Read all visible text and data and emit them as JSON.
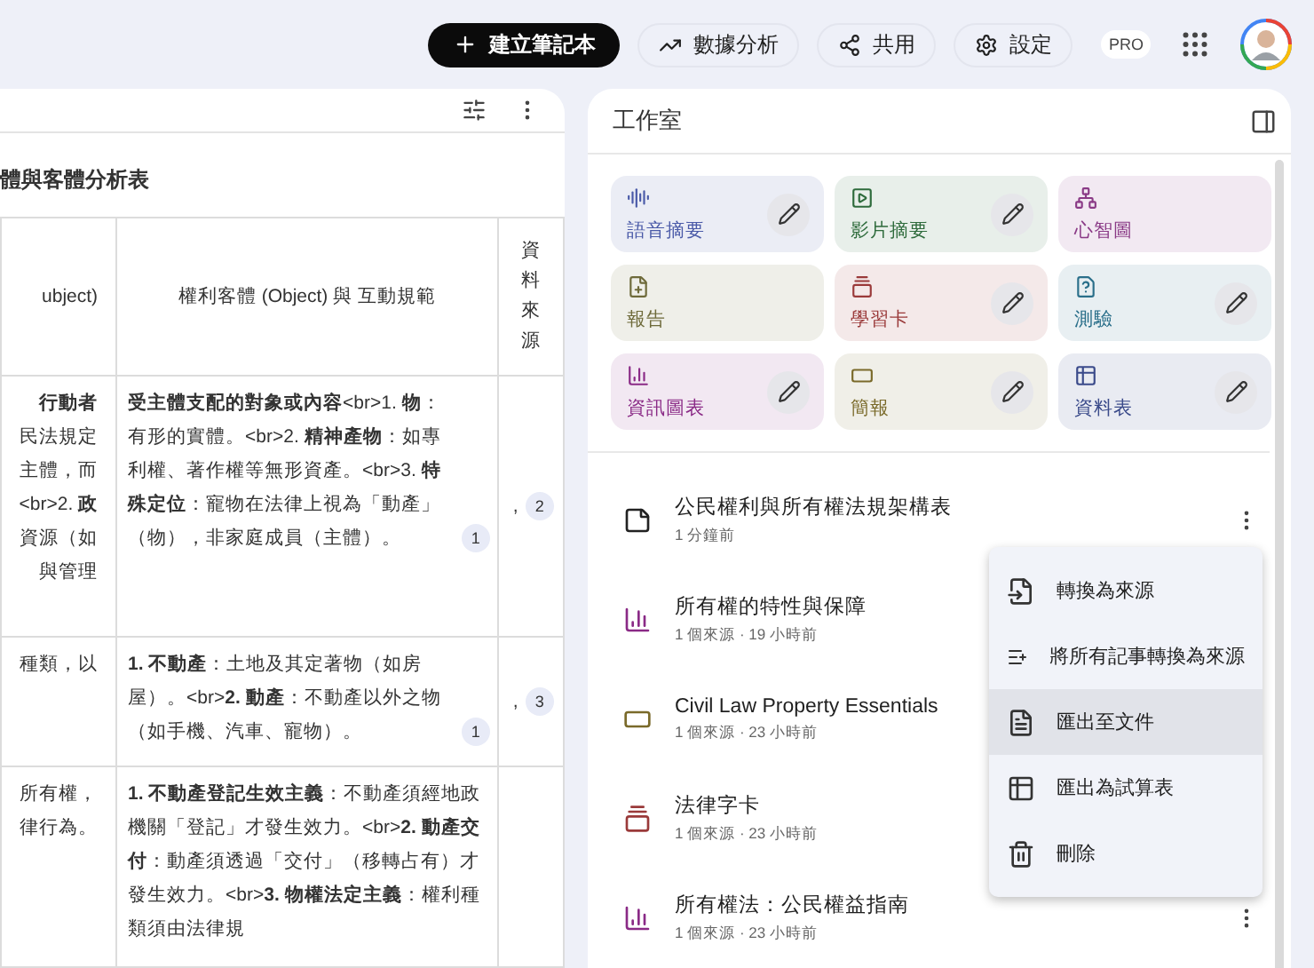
{
  "topbar": {
    "create_button": "建立筆記本",
    "buttons": [
      {
        "kind": "analytics",
        "label": "數據分析"
      },
      {
        "kind": "share",
        "label": "共用"
      },
      {
        "kind": "settings",
        "label": "設定"
      }
    ],
    "badge": "PRO"
  },
  "document": {
    "title": "體與客體分析表",
    "header": [
      "ubject)",
      "權利客體 (Object) 與 互動規範",
      "資料來源"
    ],
    "rows": [
      {
        "col1": [
          {
            "text": "**行動者**"
          },
          {
            "text": "民法規定"
          },
          {
            "text": "主體，而"
          },
          {
            "text": "<br>2. **政**"
          },
          {
            "text": "資源（如"
          },
          {
            "text": "與管理"
          }
        ],
        "col2": "**受主體支配的對象或內容**<br>1. **物**：有形的實體。<br>2. **精神產物**：如專利權、著作權等無形資產。<br>3. **特殊定位**：寵物在法律上視為「動產」（物），非家庭成員（主體）。",
        "col2_citation": "1",
        "col3_prefix": ",",
        "col3_citation": "2"
      },
      {
        "col1": [
          {
            "text": "種類，以"
          }
        ],
        "col2": "**1. 不動產**：土地及其定著物（如房屋）。<br>**2. 動產**：不動產以外之物（如手機、汽車、寵物）。",
        "col2_citation": "1",
        "col3_prefix": ",",
        "col3_citation": "3"
      },
      {
        "col1": [
          {
            "text": "所有權，"
          },
          {
            "text": "律行為。"
          }
        ],
        "col2": "**1. 不動產登記生效主義**：不動產須經地政機關「登記」才發生效力。<br>**2. 動產交付**：動產須透過「交付」（移轉占有）才發生效力。<br>**3. 物權法定主義**：權利種類須由法律規"
      }
    ]
  },
  "studio": {
    "title": "工作室",
    "tiles": [
      {
        "kind": "audio",
        "label": "語音摘要",
        "color": "#4a5aa8",
        "editable": true
      },
      {
        "kind": "video",
        "label": "影片摘要",
        "color": "#2e6b3c",
        "editable": true
      },
      {
        "kind": "mindmap",
        "label": "心智圖",
        "color": "#8a3a86",
        "editable": false
      },
      {
        "kind": "report",
        "label": "報告",
        "color": "#6e6a3a",
        "editable": false
      },
      {
        "kind": "flashcards",
        "label": "學習卡",
        "color": "#9a3a3a",
        "editable": true
      },
      {
        "kind": "quiz",
        "label": "測驗",
        "color": "#2a6f8a",
        "editable": true
      },
      {
        "kind": "infographic",
        "label": "資訊圖表",
        "color": "#8a2a86",
        "editable": true
      },
      {
        "kind": "slides",
        "label": "簡報",
        "color": "#7a6a2a",
        "editable": true
      },
      {
        "kind": "table",
        "label": "資料表",
        "color": "#3a4a8a",
        "editable": true
      }
    ],
    "notes": [
      {
        "kind": "note",
        "title": "公民權利與所有權法規架構表",
        "meta": "1 分鐘前",
        "more": true
      },
      {
        "kind": "infographic",
        "title": "所有權的特性與保障",
        "meta": "1 個來源 · 19 小時前"
      },
      {
        "kind": "slides",
        "title": "Civil Law Property Essentials",
        "meta": "1 個來源 · 23 小時前"
      },
      {
        "kind": "flashcards",
        "title": "法律字卡",
        "meta": "1 個來源 · 23 小時前"
      },
      {
        "kind": "infographic",
        "title": "所有權法：公民權益指南",
        "meta": "1 個來源 · 23 小時前",
        "more": true
      }
    ],
    "menu": [
      {
        "kind": "convert",
        "label": "轉換為來源",
        "selected": false
      },
      {
        "kind": "convert_all",
        "label": "將所有記事轉換為來源",
        "selected": false
      },
      {
        "kind": "doc",
        "label": "匯出至文件",
        "selected": true
      },
      {
        "kind": "sheet",
        "label": "匯出為試算表",
        "selected": false
      },
      {
        "kind": "delete",
        "label": "刪除",
        "selected": false
      }
    ]
  }
}
